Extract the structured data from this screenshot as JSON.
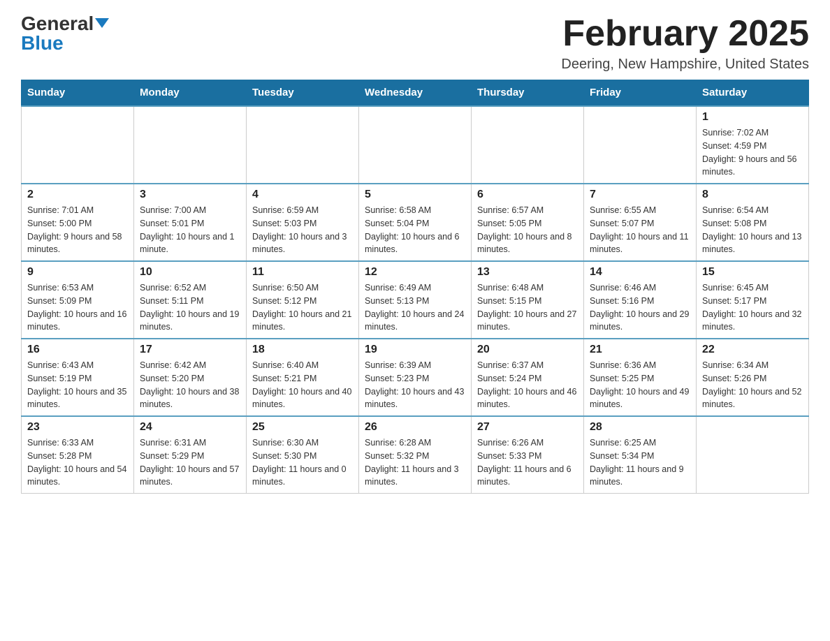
{
  "header": {
    "logo_general": "General",
    "logo_blue": "Blue",
    "month_year": "February 2025",
    "location": "Deering, New Hampshire, United States"
  },
  "days_of_week": [
    "Sunday",
    "Monday",
    "Tuesday",
    "Wednesday",
    "Thursday",
    "Friday",
    "Saturday"
  ],
  "weeks": [
    [
      {
        "day": "",
        "info": ""
      },
      {
        "day": "",
        "info": ""
      },
      {
        "day": "",
        "info": ""
      },
      {
        "day": "",
        "info": ""
      },
      {
        "day": "",
        "info": ""
      },
      {
        "day": "",
        "info": ""
      },
      {
        "day": "1",
        "info": "Sunrise: 7:02 AM\nSunset: 4:59 PM\nDaylight: 9 hours and 56 minutes."
      }
    ],
    [
      {
        "day": "2",
        "info": "Sunrise: 7:01 AM\nSunset: 5:00 PM\nDaylight: 9 hours and 58 minutes."
      },
      {
        "day": "3",
        "info": "Sunrise: 7:00 AM\nSunset: 5:01 PM\nDaylight: 10 hours and 1 minute."
      },
      {
        "day": "4",
        "info": "Sunrise: 6:59 AM\nSunset: 5:03 PM\nDaylight: 10 hours and 3 minutes."
      },
      {
        "day": "5",
        "info": "Sunrise: 6:58 AM\nSunset: 5:04 PM\nDaylight: 10 hours and 6 minutes."
      },
      {
        "day": "6",
        "info": "Sunrise: 6:57 AM\nSunset: 5:05 PM\nDaylight: 10 hours and 8 minutes."
      },
      {
        "day": "7",
        "info": "Sunrise: 6:55 AM\nSunset: 5:07 PM\nDaylight: 10 hours and 11 minutes."
      },
      {
        "day": "8",
        "info": "Sunrise: 6:54 AM\nSunset: 5:08 PM\nDaylight: 10 hours and 13 minutes."
      }
    ],
    [
      {
        "day": "9",
        "info": "Sunrise: 6:53 AM\nSunset: 5:09 PM\nDaylight: 10 hours and 16 minutes."
      },
      {
        "day": "10",
        "info": "Sunrise: 6:52 AM\nSunset: 5:11 PM\nDaylight: 10 hours and 19 minutes."
      },
      {
        "day": "11",
        "info": "Sunrise: 6:50 AM\nSunset: 5:12 PM\nDaylight: 10 hours and 21 minutes."
      },
      {
        "day": "12",
        "info": "Sunrise: 6:49 AM\nSunset: 5:13 PM\nDaylight: 10 hours and 24 minutes."
      },
      {
        "day": "13",
        "info": "Sunrise: 6:48 AM\nSunset: 5:15 PM\nDaylight: 10 hours and 27 minutes."
      },
      {
        "day": "14",
        "info": "Sunrise: 6:46 AM\nSunset: 5:16 PM\nDaylight: 10 hours and 29 minutes."
      },
      {
        "day": "15",
        "info": "Sunrise: 6:45 AM\nSunset: 5:17 PM\nDaylight: 10 hours and 32 minutes."
      }
    ],
    [
      {
        "day": "16",
        "info": "Sunrise: 6:43 AM\nSunset: 5:19 PM\nDaylight: 10 hours and 35 minutes."
      },
      {
        "day": "17",
        "info": "Sunrise: 6:42 AM\nSunset: 5:20 PM\nDaylight: 10 hours and 38 minutes."
      },
      {
        "day": "18",
        "info": "Sunrise: 6:40 AM\nSunset: 5:21 PM\nDaylight: 10 hours and 40 minutes."
      },
      {
        "day": "19",
        "info": "Sunrise: 6:39 AM\nSunset: 5:23 PM\nDaylight: 10 hours and 43 minutes."
      },
      {
        "day": "20",
        "info": "Sunrise: 6:37 AM\nSunset: 5:24 PM\nDaylight: 10 hours and 46 minutes."
      },
      {
        "day": "21",
        "info": "Sunrise: 6:36 AM\nSunset: 5:25 PM\nDaylight: 10 hours and 49 minutes."
      },
      {
        "day": "22",
        "info": "Sunrise: 6:34 AM\nSunset: 5:26 PM\nDaylight: 10 hours and 52 minutes."
      }
    ],
    [
      {
        "day": "23",
        "info": "Sunrise: 6:33 AM\nSunset: 5:28 PM\nDaylight: 10 hours and 54 minutes."
      },
      {
        "day": "24",
        "info": "Sunrise: 6:31 AM\nSunset: 5:29 PM\nDaylight: 10 hours and 57 minutes."
      },
      {
        "day": "25",
        "info": "Sunrise: 6:30 AM\nSunset: 5:30 PM\nDaylight: 11 hours and 0 minutes."
      },
      {
        "day": "26",
        "info": "Sunrise: 6:28 AM\nSunset: 5:32 PM\nDaylight: 11 hours and 3 minutes."
      },
      {
        "day": "27",
        "info": "Sunrise: 6:26 AM\nSunset: 5:33 PM\nDaylight: 11 hours and 6 minutes."
      },
      {
        "day": "28",
        "info": "Sunrise: 6:25 AM\nSunset: 5:34 PM\nDaylight: 11 hours and 9 minutes."
      },
      {
        "day": "",
        "info": ""
      }
    ]
  ]
}
